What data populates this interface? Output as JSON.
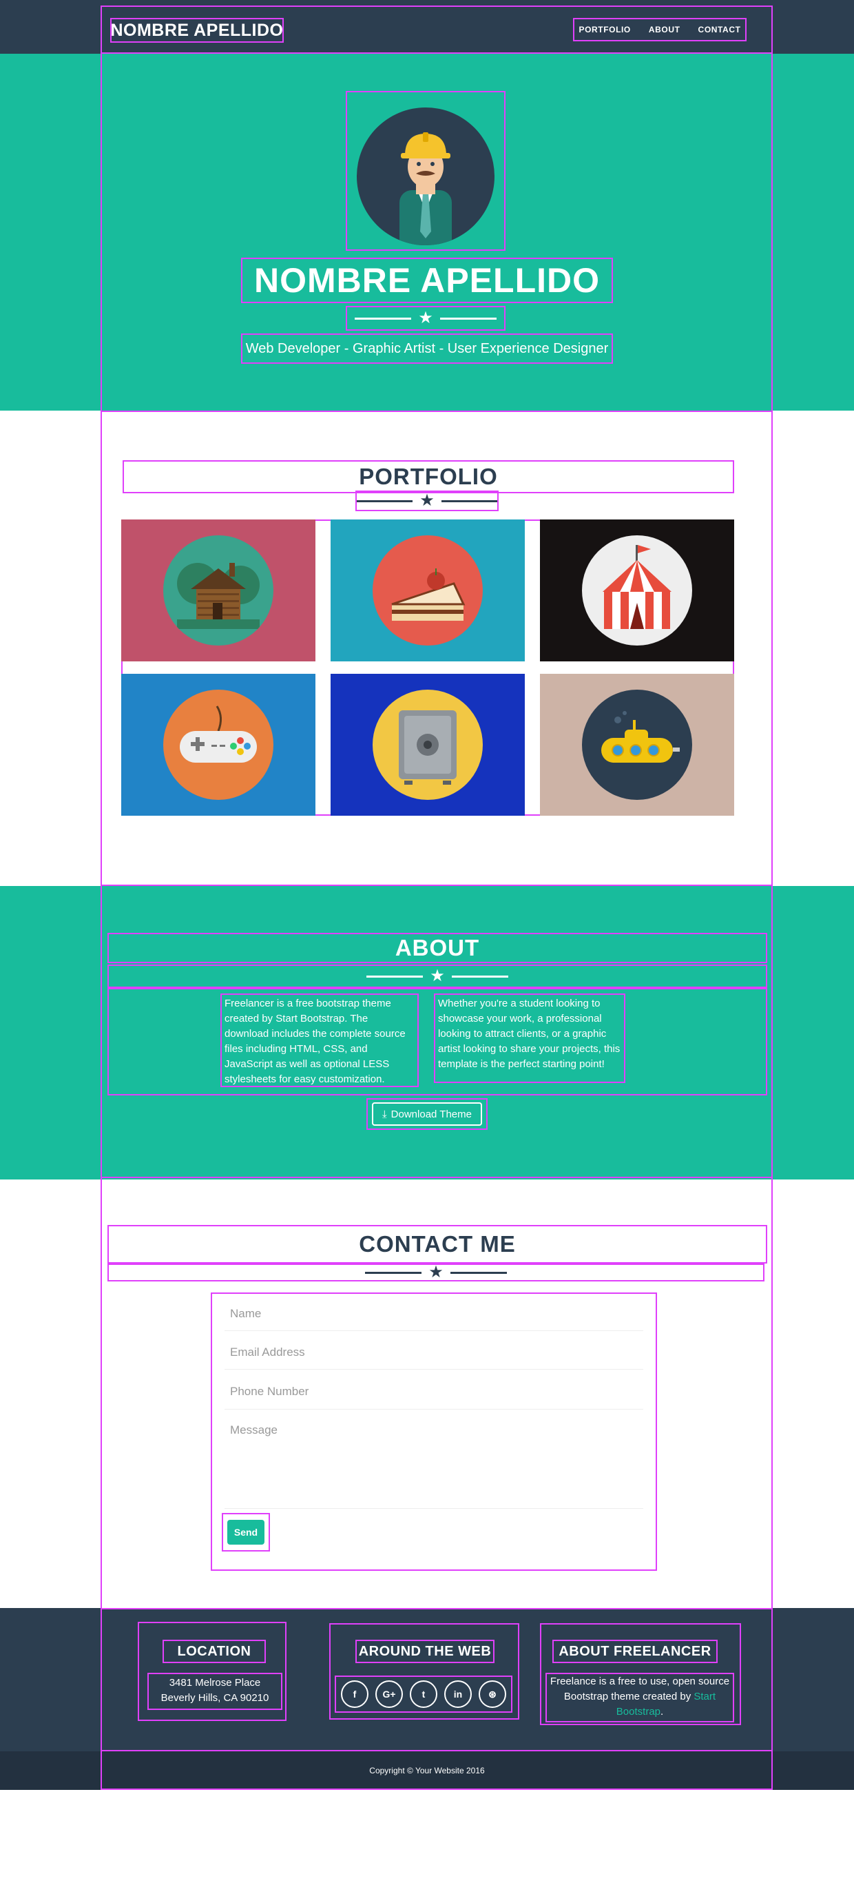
{
  "nav": {
    "brand": "NOMBRE APELLIDO",
    "links": [
      "PORTFOLIO",
      "ABOUT",
      "CONTACT"
    ]
  },
  "header": {
    "name": "NOMBRE APELLIDO",
    "skills": "Web Developer - Graphic Artist - User Experience Designer",
    "avatar_icon": "worker-avatar-icon"
  },
  "portfolio": {
    "title": "PORTFOLIO",
    "items": [
      {
        "icon": "cabin-icon",
        "bg": "#c0526a",
        "circle": "#3aa38d"
      },
      {
        "icon": "cake-icon",
        "bg": "#22a5be",
        "circle": "#e55b4d"
      },
      {
        "icon": "circus-tent-icon",
        "bg": "#161212",
        "circle": "#eeeeee"
      },
      {
        "icon": "game-controller-icon",
        "bg": "#2184c7",
        "circle": "#e8803f"
      },
      {
        "icon": "safe-icon",
        "bg": "#1533bd",
        "circle": "#f2c744"
      },
      {
        "icon": "submarine-icon",
        "bg": "#cdb3a6",
        "circle": "#2c3e50"
      }
    ]
  },
  "about": {
    "title": "ABOUT",
    "col1": "Freelancer is a free bootstrap theme created by Start Bootstrap. The download includes the complete source files including HTML, CSS, and JavaScript as well as optional LESS stylesheets for easy customization.",
    "col2": "Whether you're a student looking to showcase your work, a professional looking to attract clients, or a graphic artist looking to share your projects, this template is the perfect starting point!",
    "download_label": "Download Theme"
  },
  "contact": {
    "title": "CONTACT ME",
    "name_placeholder": "Name",
    "email_placeholder": "Email Address",
    "phone_placeholder": "Phone Number",
    "message_placeholder": "Message",
    "send_label": "Send"
  },
  "footer": {
    "location_title": "LOCATION",
    "address_line1": "3481 Melrose Place",
    "address_line2": "Beverly Hills, CA 90210",
    "web_title": "AROUND THE WEB",
    "socials": [
      "f",
      "G+",
      "t",
      "in",
      "⊛"
    ],
    "about_title": "ABOUT FREELANCER",
    "about_text": "Freelance is a free to use, open source Bootstrap theme created by",
    "about_link": "Start Bootstrap",
    "copyright": "Copyright © Your Website 2016"
  },
  "colors": {
    "primary": "#18bc9c",
    "dark": "#2c3e50",
    "footer_dark": "#233140"
  }
}
